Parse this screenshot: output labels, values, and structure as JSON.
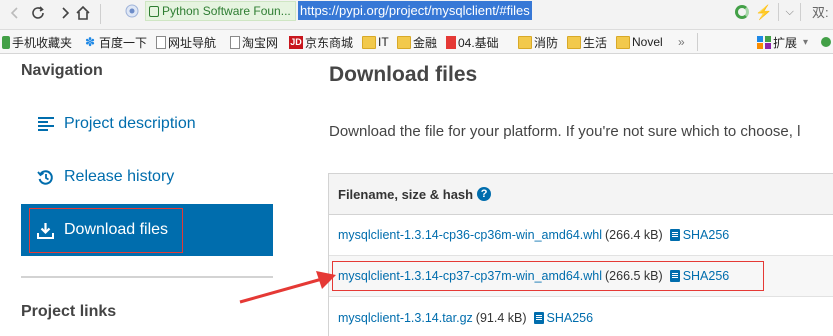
{
  "browser": {
    "site_name": "Python Software Foun...",
    "url": "https://pypi.org/project/mysqlclient/#files",
    "right_text": "双:"
  },
  "bookmarks": [
    {
      "label": "手机收藏夹",
      "icon": "green"
    },
    {
      "label": "百度一下",
      "icon": "paw"
    },
    {
      "label": "网址导航",
      "icon": "page"
    },
    {
      "label": "淘宝网",
      "icon": "page"
    },
    {
      "label": "京东商城",
      "icon": "jd"
    },
    {
      "label": "IT",
      "icon": "folder"
    },
    {
      "label": "金融",
      "icon": "folder"
    },
    {
      "label": "04.基础",
      "icon": "badge"
    },
    {
      "label": "消防",
      "icon": "folder"
    },
    {
      "label": "生活",
      "icon": "folder"
    },
    {
      "label": "Novel",
      "icon": "folder"
    }
  ],
  "bookmarks_more": "»",
  "bookmarks_ext": "扩展",
  "sidebar": {
    "heading": "Navigation",
    "items": [
      {
        "label": "Project description",
        "icon": "align-left-icon"
      },
      {
        "label": "Release history",
        "icon": "history-icon"
      },
      {
        "label": "Download files",
        "icon": "download-icon",
        "active": true
      }
    ],
    "links_heading": "Project links"
  },
  "main": {
    "title": "Download files",
    "intro": "Download the file for your platform. If you're not sure which to choose, l",
    "table_header": "Filename, size & hash",
    "help_glyph": "?",
    "files": [
      {
        "name": "mysqlclient-1.3.14-cp36-cp36m-win_amd64.whl",
        "size": "(266.4 kB)",
        "hash": "SHA256"
      },
      {
        "name": "mysqlclient-1.3.14-cp37-cp37m-win_amd64.whl",
        "size": "(266.5 kB)",
        "hash": "SHA256"
      },
      {
        "name": "mysqlclient-1.3.14.tar.gz",
        "size": "(91.4 kB)",
        "hash": "SHA256"
      }
    ]
  },
  "colors": {
    "accent": "#006dad",
    "annotation": "#e53935"
  }
}
